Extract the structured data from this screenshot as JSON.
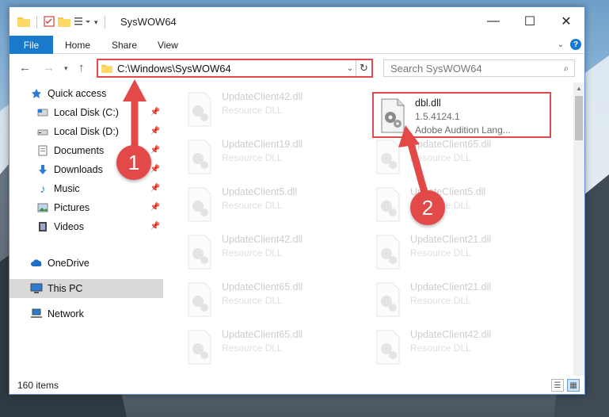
{
  "window": {
    "title": "SysWOW64",
    "controls": [
      "—",
      "☐",
      "✕"
    ]
  },
  "ribbon": {
    "tabs": [
      "File",
      "Home",
      "Share",
      "View"
    ]
  },
  "navigation": {
    "address": "C:\\Windows\\SysWOW64",
    "search_placeholder": "Search SysWOW64"
  },
  "sidebar": {
    "items": [
      {
        "label": "Quick access",
        "icon": "star-icon",
        "pinned": false
      },
      {
        "label": "Local Disk (C:)",
        "icon": "drive-icon",
        "pinned": true
      },
      {
        "label": "Local Disk (D:)",
        "icon": "drive-icon",
        "pinned": true
      },
      {
        "label": "Documents",
        "icon": "documents-icon",
        "pinned": true
      },
      {
        "label": "Downloads",
        "icon": "download-icon",
        "pinned": true
      },
      {
        "label": "Music",
        "icon": "music-icon",
        "pinned": true
      },
      {
        "label": "Pictures",
        "icon": "pictures-icon",
        "pinned": true
      },
      {
        "label": "Videos",
        "icon": "videos-icon",
        "pinned": true
      },
      {
        "label": "OneDrive",
        "icon": "cloud-icon",
        "pinned": false
      },
      {
        "label": "This PC",
        "icon": "computer-icon",
        "pinned": false,
        "selected": true
      },
      {
        "label": "Network",
        "icon": "network-icon",
        "pinned": false
      }
    ]
  },
  "files": {
    "left_column": [
      {
        "name": "UpdateClient42.dll",
        "type": "Resource DLL"
      },
      {
        "name": "UpdateClient19.dll",
        "type": "Resource DLL"
      },
      {
        "name": "UpdateClient5.dll",
        "type": "Resource DLL"
      },
      {
        "name": "UpdateClient42.dll",
        "type": "Resource DLL"
      },
      {
        "name": "UpdateClient65.dll",
        "type": "Resource DLL"
      },
      {
        "name": "UpdateClient65.dll",
        "type": "Resource DLL"
      }
    ],
    "highlighted": {
      "name": "dbl.dll",
      "version": "1.5.4124.1",
      "description": "Adobe Audition Lang..."
    },
    "right_column": [
      {
        "name": "UpdateClient65.dll",
        "type": "Resource DLL"
      },
      {
        "name": "UpdateClient5.dll",
        "type": "Resource DLL"
      },
      {
        "name": "UpdateClient21.dll",
        "type": "Resource DLL"
      },
      {
        "name": "UpdateClient21.dll",
        "type": "Resource DLL"
      },
      {
        "name": "UpdateClient42.dll",
        "type": "Resource DLL"
      }
    ]
  },
  "status": {
    "item_count": "160 items"
  },
  "callouts": [
    "1",
    "2"
  ],
  "colors": {
    "accent": "#1979ca",
    "highlight": "#e34949"
  }
}
